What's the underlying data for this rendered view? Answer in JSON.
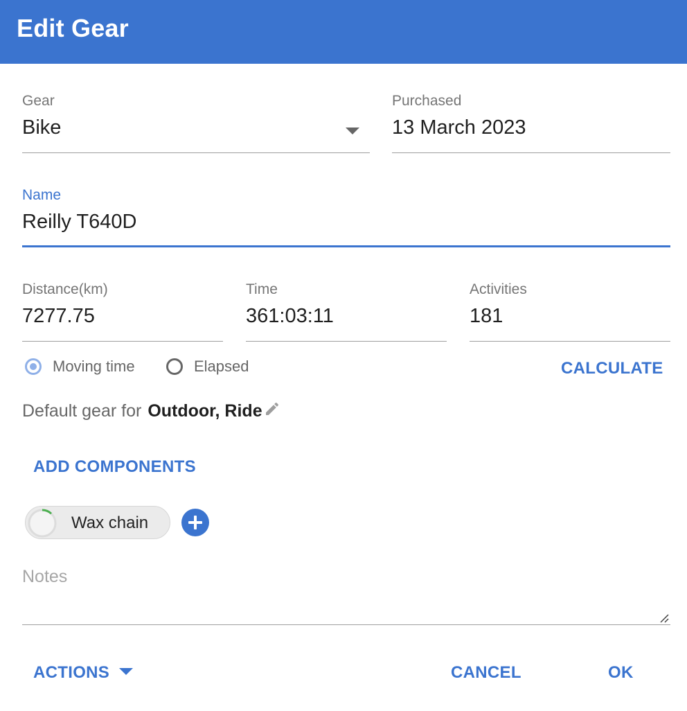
{
  "title": "Edit Gear",
  "colors": {
    "primary": "#3b74cf",
    "chip_progress": "#4caf50"
  },
  "gear": {
    "label": "Gear",
    "value": "Bike",
    "icon": "dropdown-arrow-icon"
  },
  "purchased": {
    "label": "Purchased",
    "value": "13 March 2023"
  },
  "name": {
    "label": "Name",
    "value": "Reilly T640D"
  },
  "stats": {
    "distance": {
      "label": "Distance(km)",
      "value": "7277.75"
    },
    "time": {
      "label": "Time",
      "value": "361:03:11"
    },
    "activities": {
      "label": "Activities",
      "value": "181"
    }
  },
  "time_mode": {
    "options": [
      "Moving time",
      "Elapsed"
    ],
    "selected": "Moving time"
  },
  "calculate_label": "CALCULATE",
  "default_gear": {
    "prefix": "Default gear for",
    "value": "Outdoor, Ride",
    "icon": "edit-pencil-icon"
  },
  "add_components_label": "ADD COMPONENTS",
  "components": [
    {
      "label": "Wax chain",
      "progress": 0.12
    }
  ],
  "notes": {
    "placeholder": "Notes"
  },
  "footer": {
    "actions_label": "ACTIONS",
    "cancel_label": "CANCEL",
    "ok_label": "OK"
  }
}
